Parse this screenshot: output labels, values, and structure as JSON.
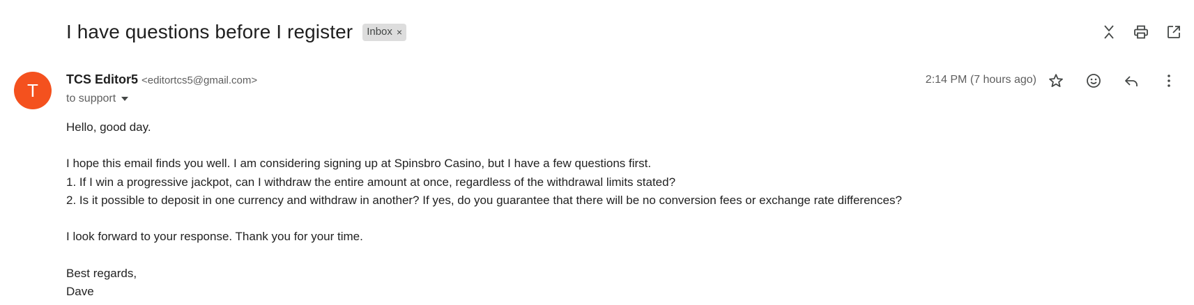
{
  "thread": {
    "subject": "I have questions before I register",
    "label": "Inbox",
    "label_remove_glyph": "×"
  },
  "thread_actions": {
    "icons": [
      "collapse-all-icon",
      "print-icon",
      "open-in-new-window-icon"
    ]
  },
  "message": {
    "avatar_letter": "T",
    "avatar_color": "#f4511e",
    "sender_name": "TCS Editor5",
    "sender_email": "<editortcs5@gmail.com>",
    "recipient": "to support",
    "timestamp": "2:14 PM (7 hours ago)",
    "actions": [
      "star-icon",
      "emoji-react-icon",
      "reply-icon",
      "more-options-icon"
    ],
    "body": {
      "greeting": "Hello, good day.",
      "line1": "I hope this email finds you well. I am considering signing up at Spinsbro Casino, but I have a few questions first.",
      "line2": "1. If I win a progressive jackpot, can I withdraw the entire amount at once, regardless of the withdrawal limits stated?",
      "line3": "2. Is it possible to deposit in one currency and withdraw in another? If yes, do you guarantee that there will be no conversion fees or exchange rate differences?",
      "closing": "I look forward to your response. Thank you for your time.",
      "signoff": "Best regards,",
      "signature": "Dave"
    }
  }
}
